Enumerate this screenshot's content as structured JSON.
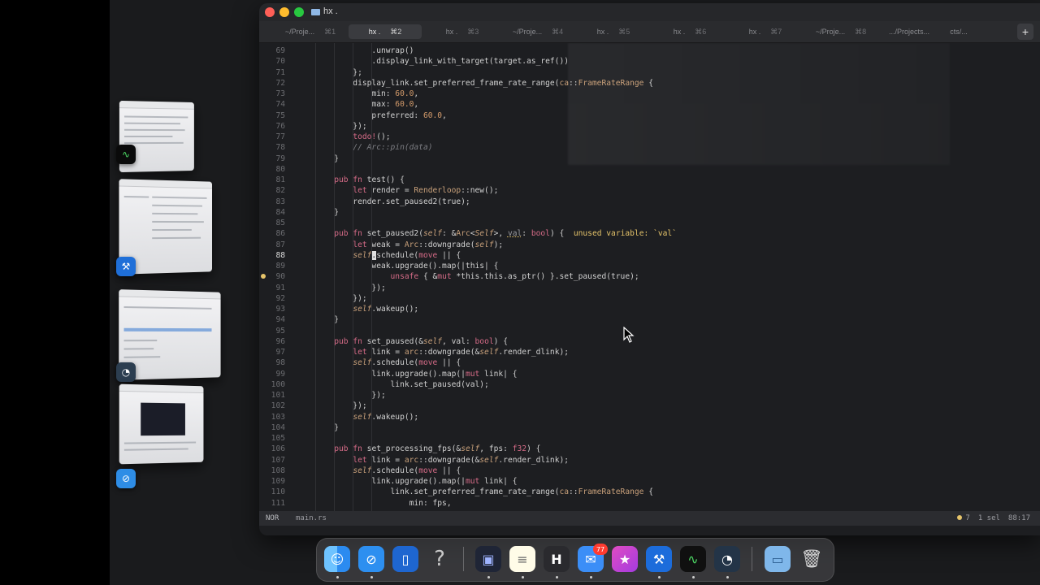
{
  "window": {
    "title": "hx ."
  },
  "tabs": [
    {
      "label": "~/Proje...",
      "key": "⌘1"
    },
    {
      "label": "hx .",
      "key": "⌘2",
      "active": true
    },
    {
      "label": "hx .",
      "key": "⌘3"
    },
    {
      "label": "~/Proje...",
      "key": "⌘4"
    },
    {
      "label": "hx .",
      "key": "⌘5"
    },
    {
      "label": "hx .",
      "key": "⌘6"
    },
    {
      "label": "hx .",
      "key": "⌘7"
    },
    {
      "label": "~/Proje...",
      "key": "⌘8"
    },
    {
      "label": ".../Projects...",
      "key": ""
    },
    {
      "label": "cts/...",
      "key": ""
    }
  ],
  "tab_add": "+",
  "code": [
    {
      "n": "69",
      "t": "                .unwrap()"
    },
    {
      "n": "70",
      "t": "                .display_link_with_target(target.as_ref())"
    },
    {
      "n": "71",
      "t": "            };"
    },
    {
      "n": "72",
      "t": "            display_link.set_preferred_frame_rate_range(ca::FrameRateRange {"
    },
    {
      "n": "73",
      "t": "                min: 60.0,"
    },
    {
      "n": "74",
      "t": "                max: 60.0,"
    },
    {
      "n": "75",
      "t": "                preferred: 60.0,"
    },
    {
      "n": "76",
      "t": "            });"
    },
    {
      "n": "77",
      "t": "            todo!();"
    },
    {
      "n": "78",
      "t": "            // Arc::pin(data)"
    },
    {
      "n": "79",
      "t": "        }"
    },
    {
      "n": "80",
      "t": ""
    },
    {
      "n": "81",
      "t": "        pub fn test() {"
    },
    {
      "n": "82",
      "t": "            let render = Renderloop::new();"
    },
    {
      "n": "83",
      "t": "            render.set_paused2(true);"
    },
    {
      "n": "84",
      "t": "        }"
    },
    {
      "n": "85",
      "t": ""
    },
    {
      "n": "86",
      "t": "        pub fn set_paused2(self: &Arc<Self>, val: bool) {  unused variable: `val`"
    },
    {
      "n": "87",
      "t": "            let weak = Arc::downgrade(self);"
    },
    {
      "n": "88",
      "t": "            self.schedule(move || {"
    },
    {
      "n": "89",
      "t": "                weak.upgrade().map(|this| {"
    },
    {
      "n": "90",
      "t": "                    unsafe { &mut *this.this.as_ptr() }.set_paused(true);"
    },
    {
      "n": "91",
      "t": "                });"
    },
    {
      "n": "92",
      "t": "            });"
    },
    {
      "n": "93",
      "t": "            self.wakeup();"
    },
    {
      "n": "94",
      "t": "        }"
    },
    {
      "n": "95",
      "t": ""
    },
    {
      "n": "96",
      "t": "        pub fn set_paused(&self, val: bool) {"
    },
    {
      "n": "97",
      "t": "            let link = arc::downgrade(&self.render_dlink);"
    },
    {
      "n": "98",
      "t": "            self.schedule(move || {"
    },
    {
      "n": "99",
      "t": "                link.upgrade().map(|mut link| {"
    },
    {
      "n": "100",
      "t": "                    link.set_paused(val);"
    },
    {
      "n": "101",
      "t": "                });"
    },
    {
      "n": "102",
      "t": "            });"
    },
    {
      "n": "103",
      "t": "            self.wakeup();"
    },
    {
      "n": "104",
      "t": "        }"
    },
    {
      "n": "105",
      "t": ""
    },
    {
      "n": "106",
      "t": "        pub fn set_processing_fps(&self, fps: f32) {"
    },
    {
      "n": "107",
      "t": "            let link = arc::downgrade(&self.render_dlink);"
    },
    {
      "n": "108",
      "t": "            self.schedule(move || {"
    },
    {
      "n": "109",
      "t": "                link.upgrade().map(|mut link| {"
    },
    {
      "n": "110",
      "t": "                    link.set_preferred_frame_rate_range(ca::FrameRateRange {"
    },
    {
      "n": "111",
      "t": "                        min: fps,"
    }
  ],
  "status": {
    "mode": "NOR",
    "file": "main.rs",
    "diagnostics": "7",
    "selection": "1 sel",
    "position": "88:17"
  },
  "dock": {
    "mail_badge": "77",
    "help_glyph": "?"
  }
}
